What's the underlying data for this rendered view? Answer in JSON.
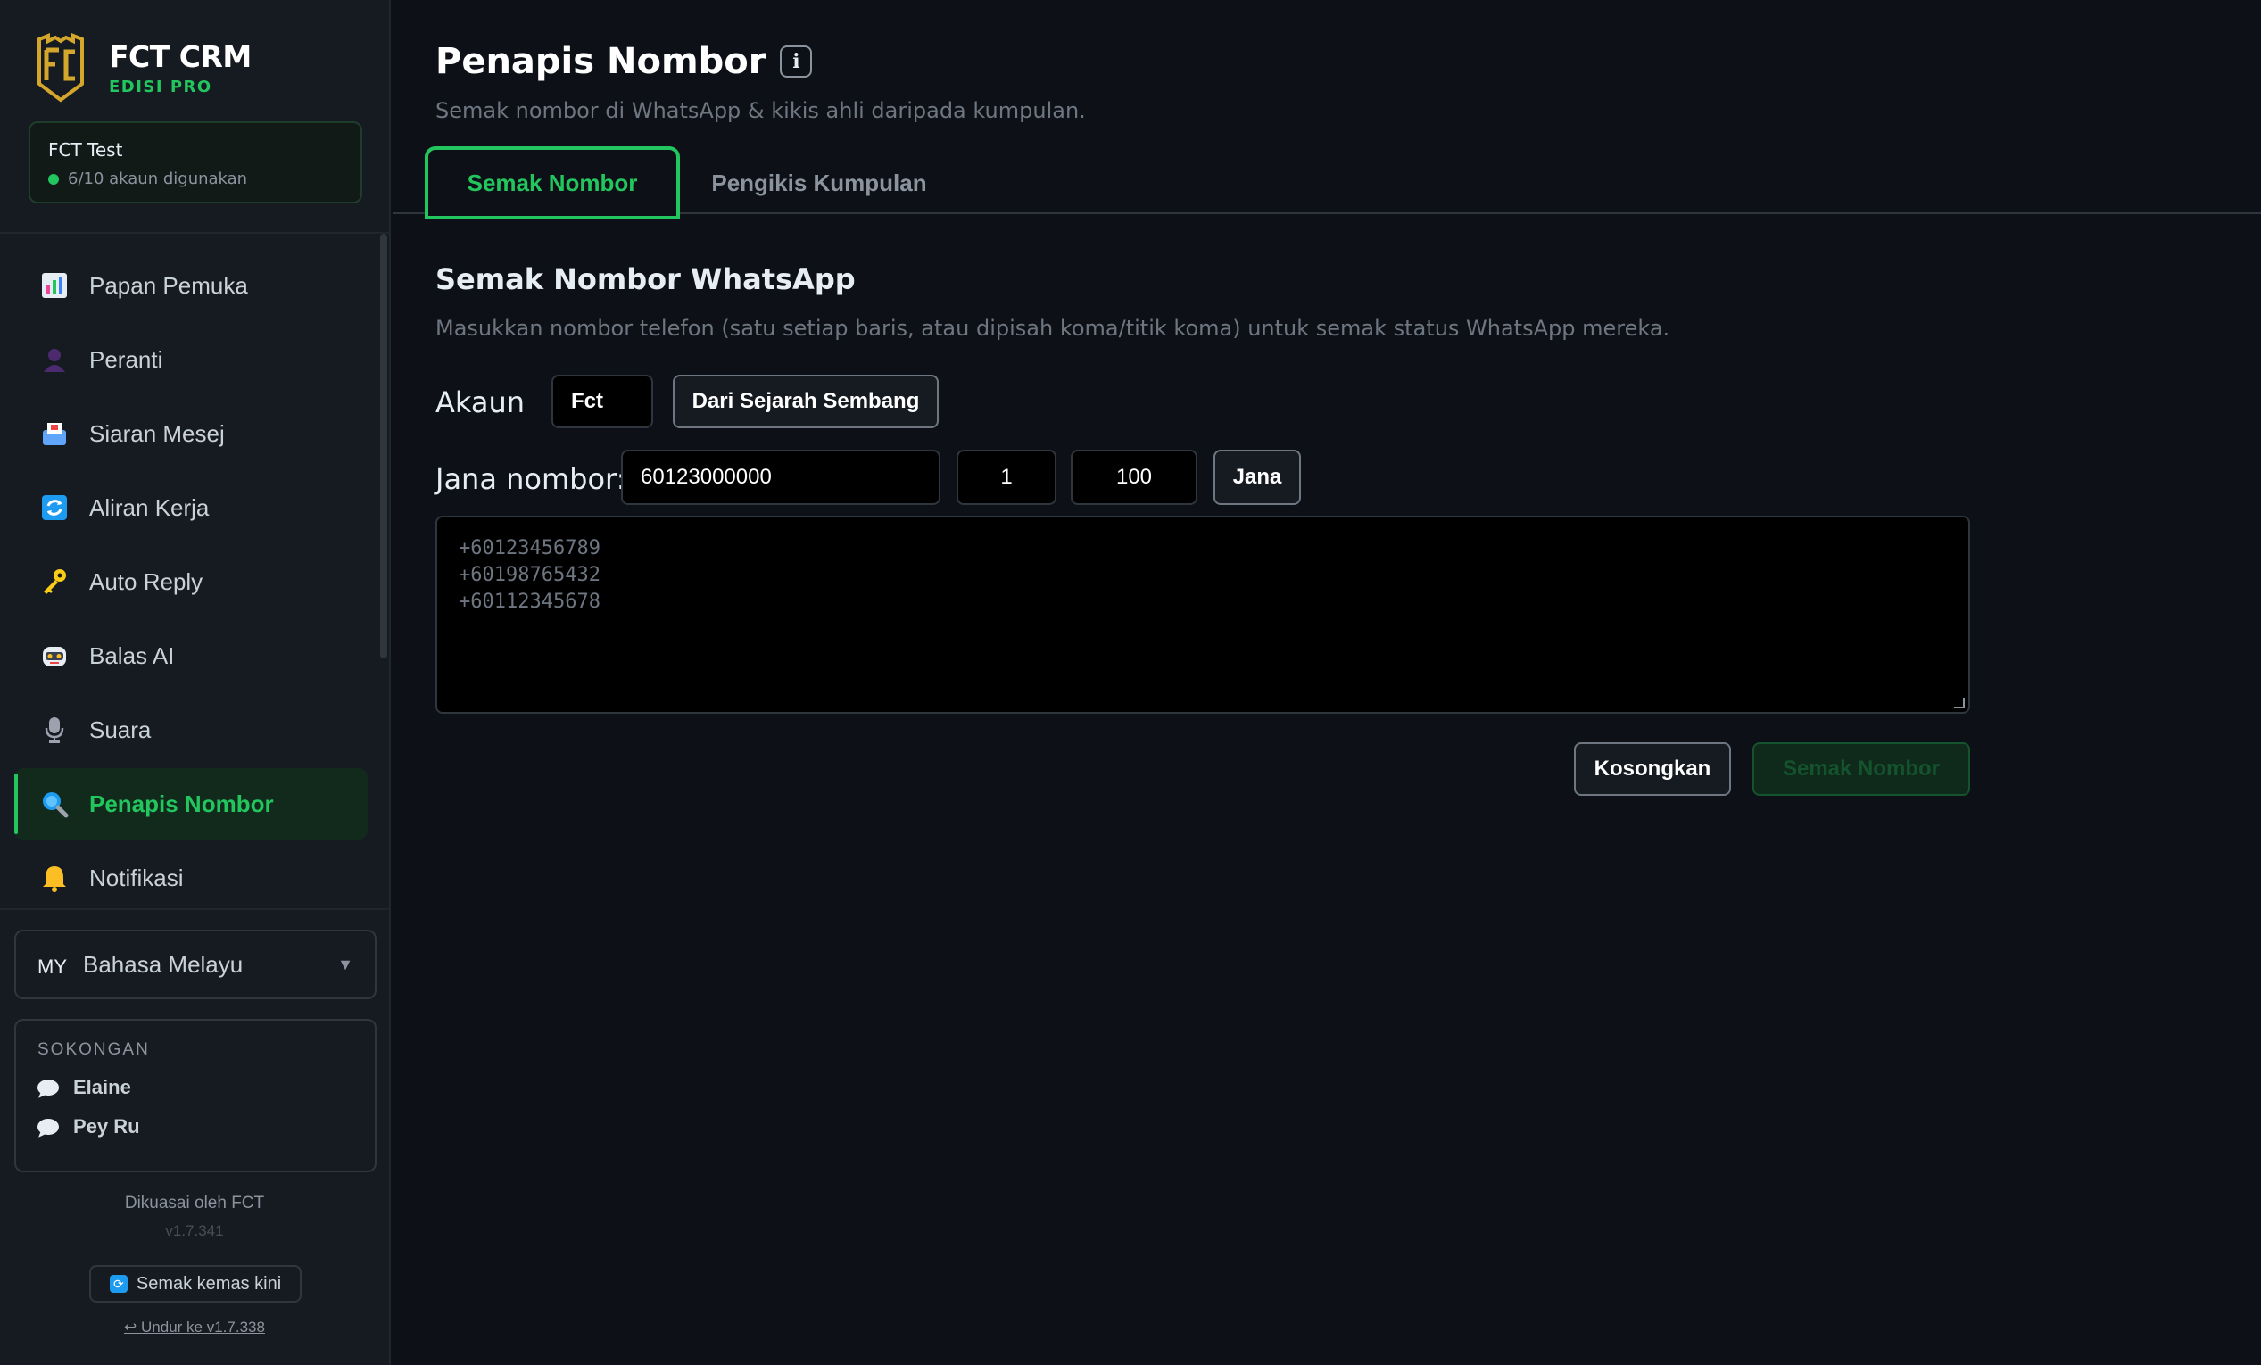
{
  "brand": {
    "title": "FCT CRM",
    "subtitle": "EDISI PRO"
  },
  "account": {
    "name": "FCT Test",
    "usage": "6/10 akaun digunakan"
  },
  "nav": {
    "items": [
      {
        "label": "Papan Pemuka",
        "icon": "dashboard-icon"
      },
      {
        "label": "Peranti",
        "icon": "device-icon"
      },
      {
        "label": "Siaran Mesej",
        "icon": "broadcast-icon"
      },
      {
        "label": "Aliran Kerja",
        "icon": "workflow-icon"
      },
      {
        "label": "Auto Reply",
        "icon": "key-icon"
      },
      {
        "label": "Balas AI",
        "icon": "robot-icon"
      },
      {
        "label": "Suara",
        "icon": "microphone-icon"
      },
      {
        "label": "Penapis Nombor",
        "icon": "magnifier-icon",
        "active": true
      },
      {
        "label": "Notifikasi",
        "icon": "bell-icon"
      }
    ]
  },
  "language": {
    "code": "MY",
    "name": "Bahasa Melayu"
  },
  "support": {
    "title": "SOKONGAN",
    "contacts": [
      "Elaine",
      "Pey Ru"
    ]
  },
  "footer": {
    "powered": "Dikuasai oleh FCT",
    "version": "v1.7.341",
    "update_label": "Semak kemas kini",
    "rollback_label": "↩ Undur ke v1.7.338"
  },
  "page": {
    "title": "Penapis Nombor",
    "subtitle": "Semak nombor di WhatsApp & kikis ahli daripada kumpulan."
  },
  "tabs": [
    "Semak Nombor",
    "Pengikis Kumpulan"
  ],
  "section": {
    "title": "Semak Nombor WhatsApp",
    "description": "Masukkan nombor telefon (satu setiap baris, atau dipisah koma/titik koma) untuk semak status WhatsApp mereka."
  },
  "form": {
    "account_label": "Akaun",
    "account_value": "Fct",
    "history_button": "Dari Sejarah Sembang",
    "generate_label": "Jana nombor:",
    "prefix_value": "60123000000",
    "start_value": "1",
    "count_value": "100",
    "generate_button": "Jana",
    "placeholder_lines": [
      "+60123456789",
      "+60198765432",
      "+60112345678"
    ],
    "clear_button": "Kosongkan",
    "check_button": "Semak Nombor"
  },
  "colors": {
    "accent": "#22c55e",
    "background": "#0d1117",
    "sidebar": "#161b22"
  }
}
